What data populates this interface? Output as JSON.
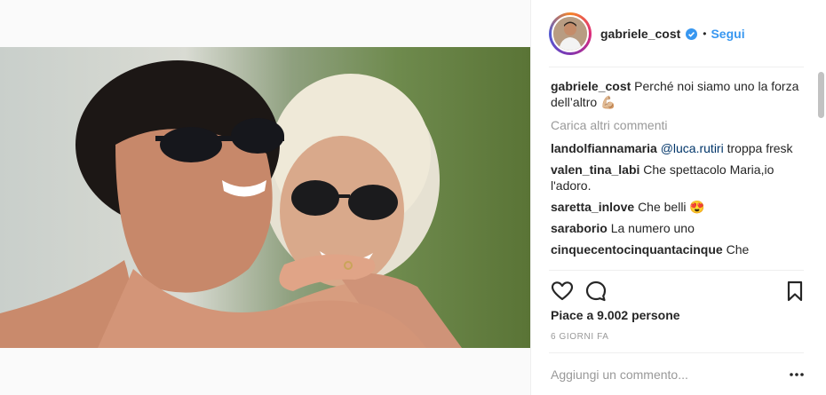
{
  "post": {
    "author": "gabriele_cost",
    "follow_label": "Segui",
    "separator": "•"
  },
  "caption": {
    "user": "gabriele_cost",
    "text": "Perché noi siamo uno la forza dell’altro 💪🏼"
  },
  "load_more_label": "Carica altri commenti",
  "comments": [
    {
      "user": "landolfiannamaria",
      "mention": "@luca.rutiri",
      "text": "troppa fresk"
    },
    {
      "user": "valen_tina_labi",
      "text": "Che spettacolo Maria,io l'adoro."
    },
    {
      "user": "saretta_inlove",
      "text": "Che belli 😍"
    },
    {
      "user": "saraborio",
      "text": "La numero uno"
    },
    {
      "user": "cinquecentocinquantacinque",
      "text": "Che"
    }
  ],
  "likes_text": "Piace a 9.002 persone",
  "timestamp": "6 GIORNI FA",
  "comment_input": {
    "placeholder": "Aggiungi un commento..."
  },
  "icons": {
    "like": "heart-icon",
    "comment": "comment-bubble-icon",
    "save": "bookmark-icon",
    "more": "more-options-icon",
    "verified": "verified-badge-icon"
  },
  "colors": {
    "link_blue": "#3897f0",
    "text": "#262626",
    "muted": "#999999"
  }
}
